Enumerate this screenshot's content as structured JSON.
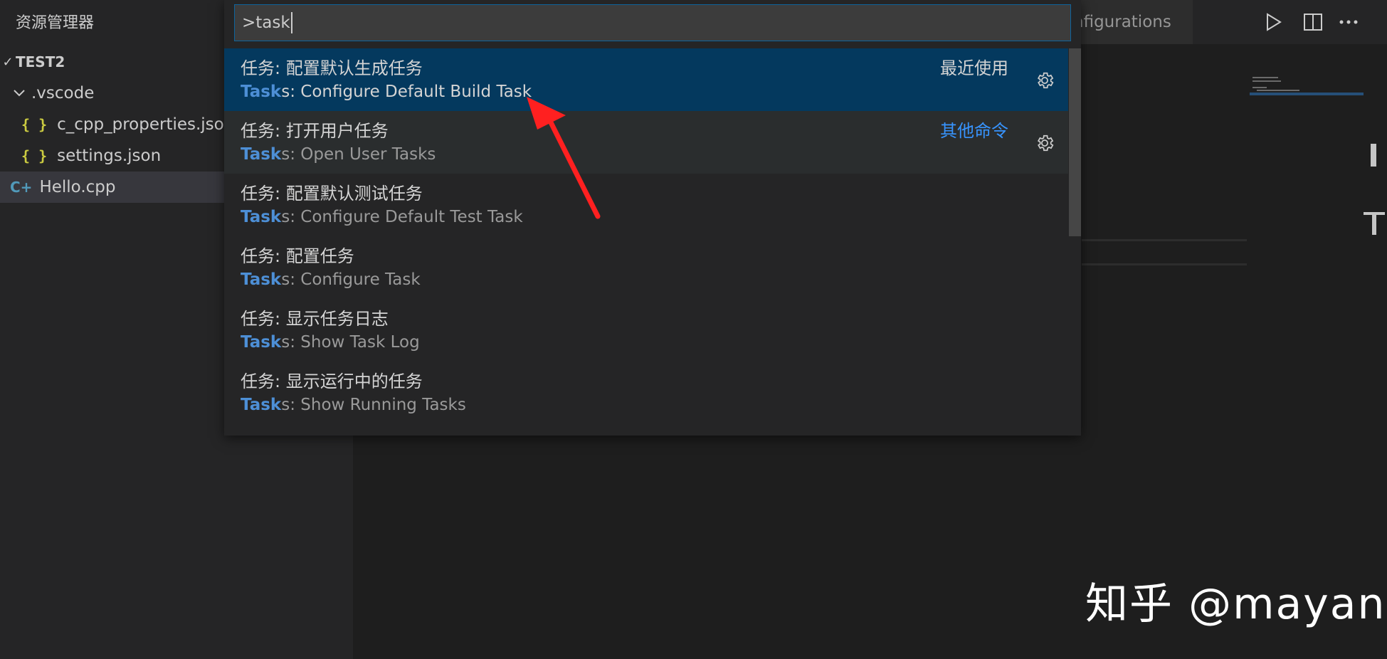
{
  "sidebar": {
    "title": "资源管理器",
    "folder": "TEST2",
    "items": [
      {
        "label": ".vscode",
        "type": "folder"
      },
      {
        "label": "c_cpp_properties.json",
        "type": "json",
        "icon": "{ }"
      },
      {
        "label": "settings.json",
        "type": "json",
        "icon": "{ }"
      },
      {
        "label": "Hello.cpp",
        "type": "cpp",
        "icon": "C+"
      }
    ]
  },
  "tabs": {
    "partial_label": "nfigurations"
  },
  "palette": {
    "input_value": ">task",
    "items": [
      {
        "title": "任务: 配置默认生成任务",
        "match": "Task",
        "rest": "s: Configure Default Build Task",
        "tag": "最近使用"
      },
      {
        "title": "任务: 打开用户任务",
        "match": "Task",
        "rest": "s: Open User Tasks",
        "tag": "其他命令"
      },
      {
        "title": "任务: 配置默认测试任务",
        "match": "Task",
        "rest": "s: Configure Default Test Task"
      },
      {
        "title": "任务: 配置任务",
        "match": "Task",
        "rest": "s: Configure Task"
      },
      {
        "title": "任务: 显示任务日志",
        "match": "Task",
        "rest": "s: Show Task Log"
      },
      {
        "title": "任务: 显示运行中的任务",
        "match": "Task",
        "rest": "s: Show Running Tasks"
      }
    ]
  },
  "watermark": "知乎 @mayan",
  "colors": {
    "focus_border": "#0e639c",
    "match_highlight": "#4d8fd6",
    "focused_row": "#04395e",
    "annotation_arrow": "#ff2020"
  }
}
